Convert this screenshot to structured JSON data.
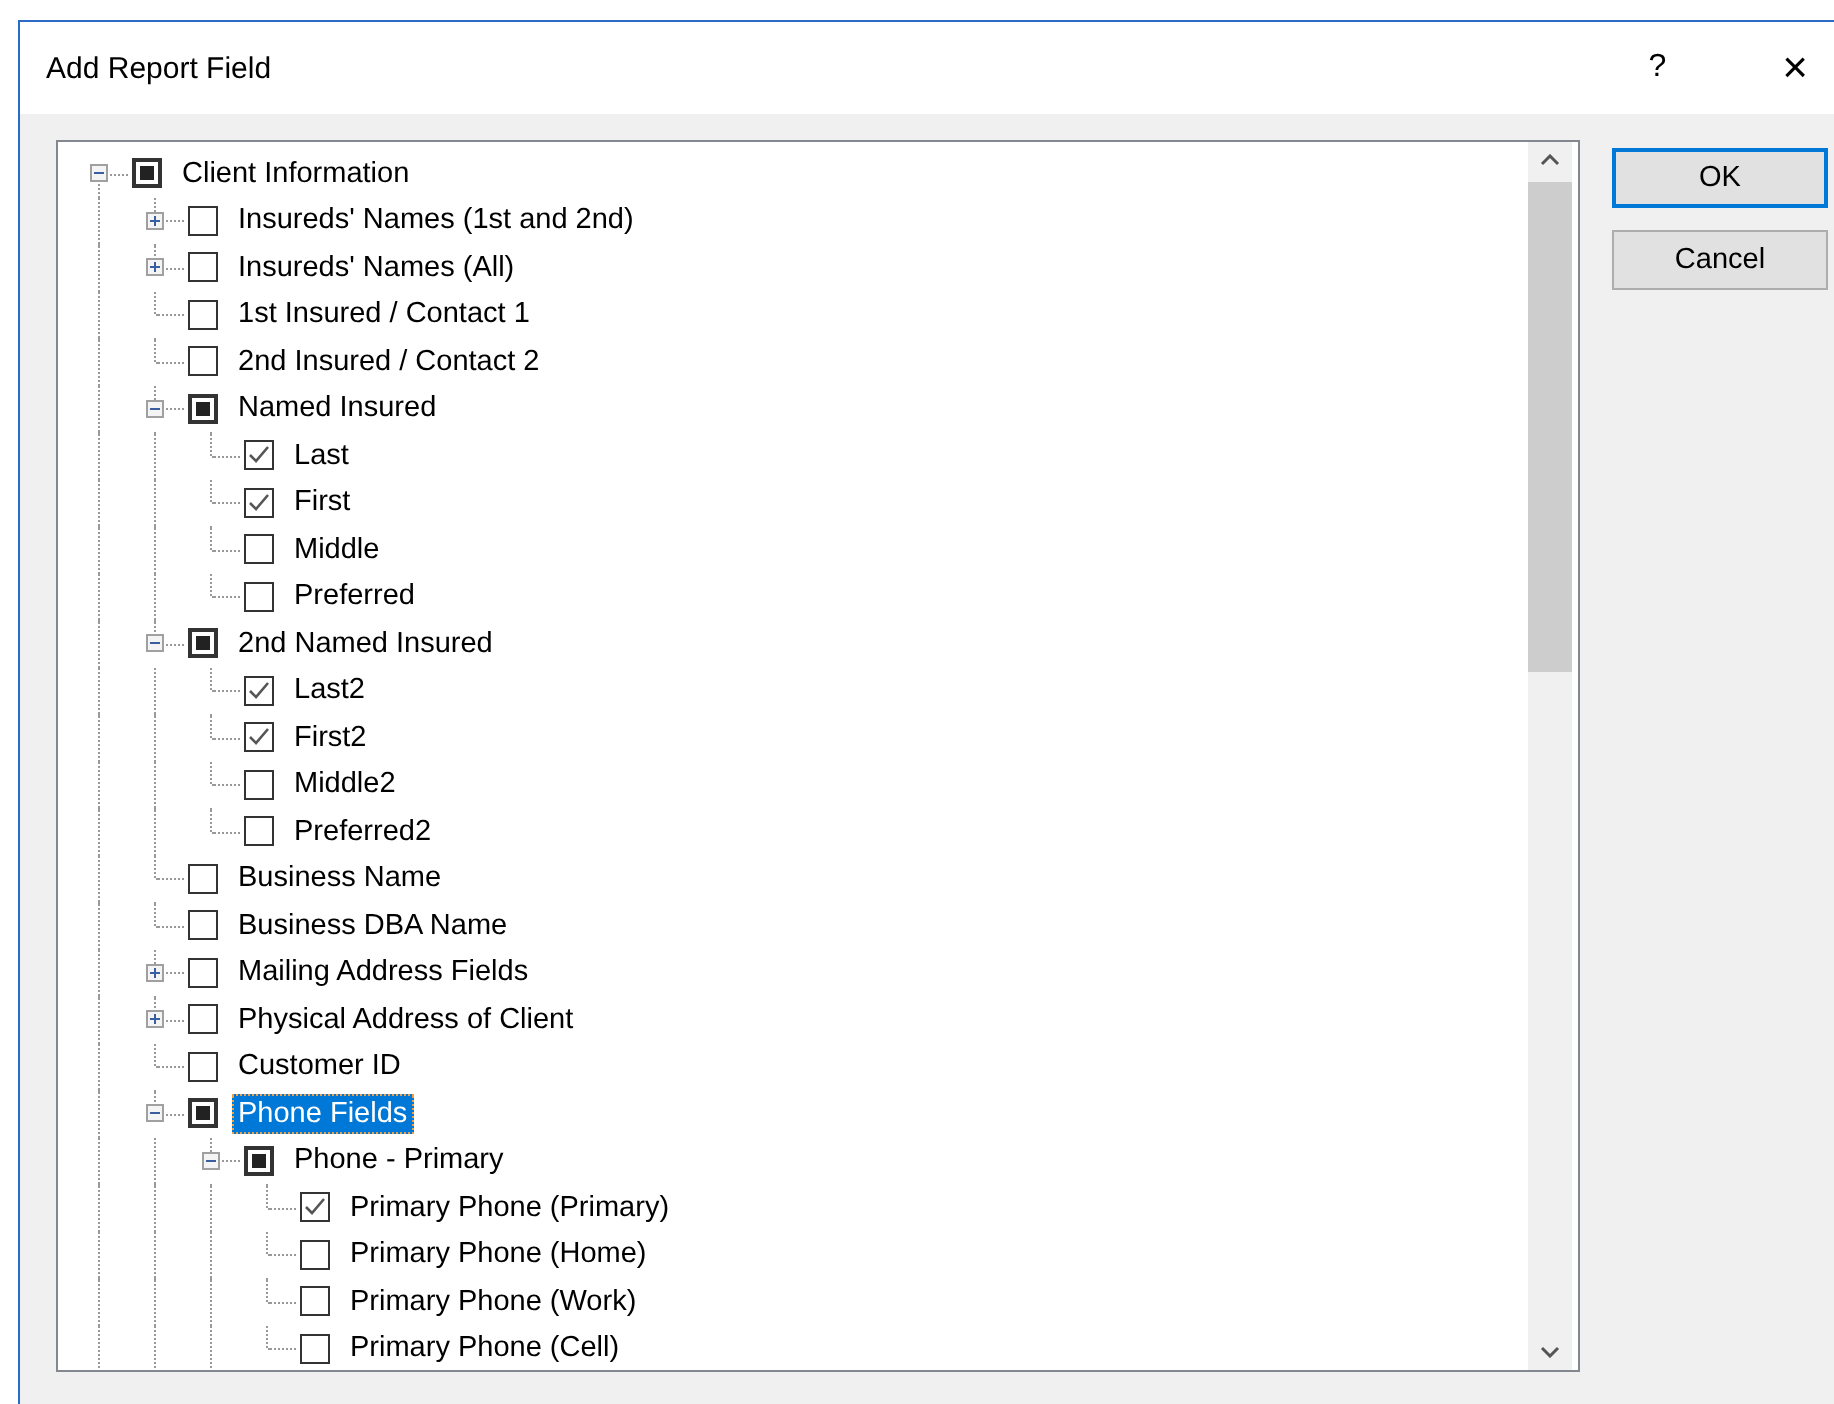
{
  "dialog": {
    "title": "Add Report Field",
    "help_button": "?",
    "close_button": "×"
  },
  "tree": [
    {
      "label": "Client Information",
      "checked": false,
      "partial": true,
      "expanded": true,
      "selected": false,
      "children": [
        {
          "label": "Insureds' Names (1st and 2nd)",
          "checked": false,
          "partial": false,
          "expanded": false,
          "selected": false
        },
        {
          "label": "Insureds' Names (All)",
          "checked": false,
          "partial": false,
          "expanded": false,
          "selected": false
        },
        {
          "label": "1st Insured / Contact 1",
          "checked": false,
          "partial": false,
          "selected": false
        },
        {
          "label": "2nd Insured / Contact 2",
          "checked": false,
          "partial": false,
          "selected": false
        },
        {
          "label": "Named Insured",
          "checked": false,
          "partial": true,
          "expanded": true,
          "selected": false,
          "children": [
            {
              "label": "Last",
              "checked": true,
              "partial": false,
              "selected": false
            },
            {
              "label": "First",
              "checked": true,
              "partial": false,
              "selected": false
            },
            {
              "label": "Middle",
              "checked": false,
              "partial": false,
              "selected": false
            },
            {
              "label": "Preferred",
              "checked": false,
              "partial": false,
              "selected": false
            }
          ]
        },
        {
          "label": "2nd Named Insured",
          "checked": false,
          "partial": true,
          "expanded": true,
          "selected": false,
          "children": [
            {
              "label": "Last2",
              "checked": true,
              "partial": false,
              "selected": false
            },
            {
              "label": "First2",
              "checked": true,
              "partial": false,
              "selected": false
            },
            {
              "label": "Middle2",
              "checked": false,
              "partial": false,
              "selected": false
            },
            {
              "label": "Preferred2",
              "checked": false,
              "partial": false,
              "selected": false
            }
          ]
        },
        {
          "label": "Business Name",
          "checked": false,
          "partial": false,
          "selected": false
        },
        {
          "label": "Business DBA Name",
          "checked": false,
          "partial": false,
          "selected": false
        },
        {
          "label": "Mailing Address Fields",
          "checked": false,
          "partial": false,
          "expanded": false,
          "selected": false
        },
        {
          "label": "Physical Address of Client",
          "checked": false,
          "partial": false,
          "expanded": false,
          "selected": false
        },
        {
          "label": "Customer ID",
          "checked": false,
          "partial": false,
          "selected": false
        },
        {
          "label": "Phone Fields",
          "checked": false,
          "partial": true,
          "expanded": true,
          "selected": true,
          "children": [
            {
              "label": "Phone - Primary",
              "checked": false,
              "partial": true,
              "expanded": true,
              "selected": false,
              "children": [
                {
                  "label": "Primary Phone (Primary)",
                  "checked": true,
                  "partial": false,
                  "selected": false
                },
                {
                  "label": "Primary Phone (Home)",
                  "checked": false,
                  "partial": false,
                  "selected": false
                },
                {
                  "label": "Primary Phone (Work)",
                  "checked": false,
                  "partial": false,
                  "selected": false
                },
                {
                  "label": "Primary Phone (Cell)",
                  "checked": false,
                  "partial": false,
                  "selected": false
                }
              ]
            }
          ]
        }
      ]
    }
  ],
  "buttons": [
    {
      "label": "OK",
      "default": true
    },
    {
      "label": "Cancel",
      "default": false
    }
  ]
}
